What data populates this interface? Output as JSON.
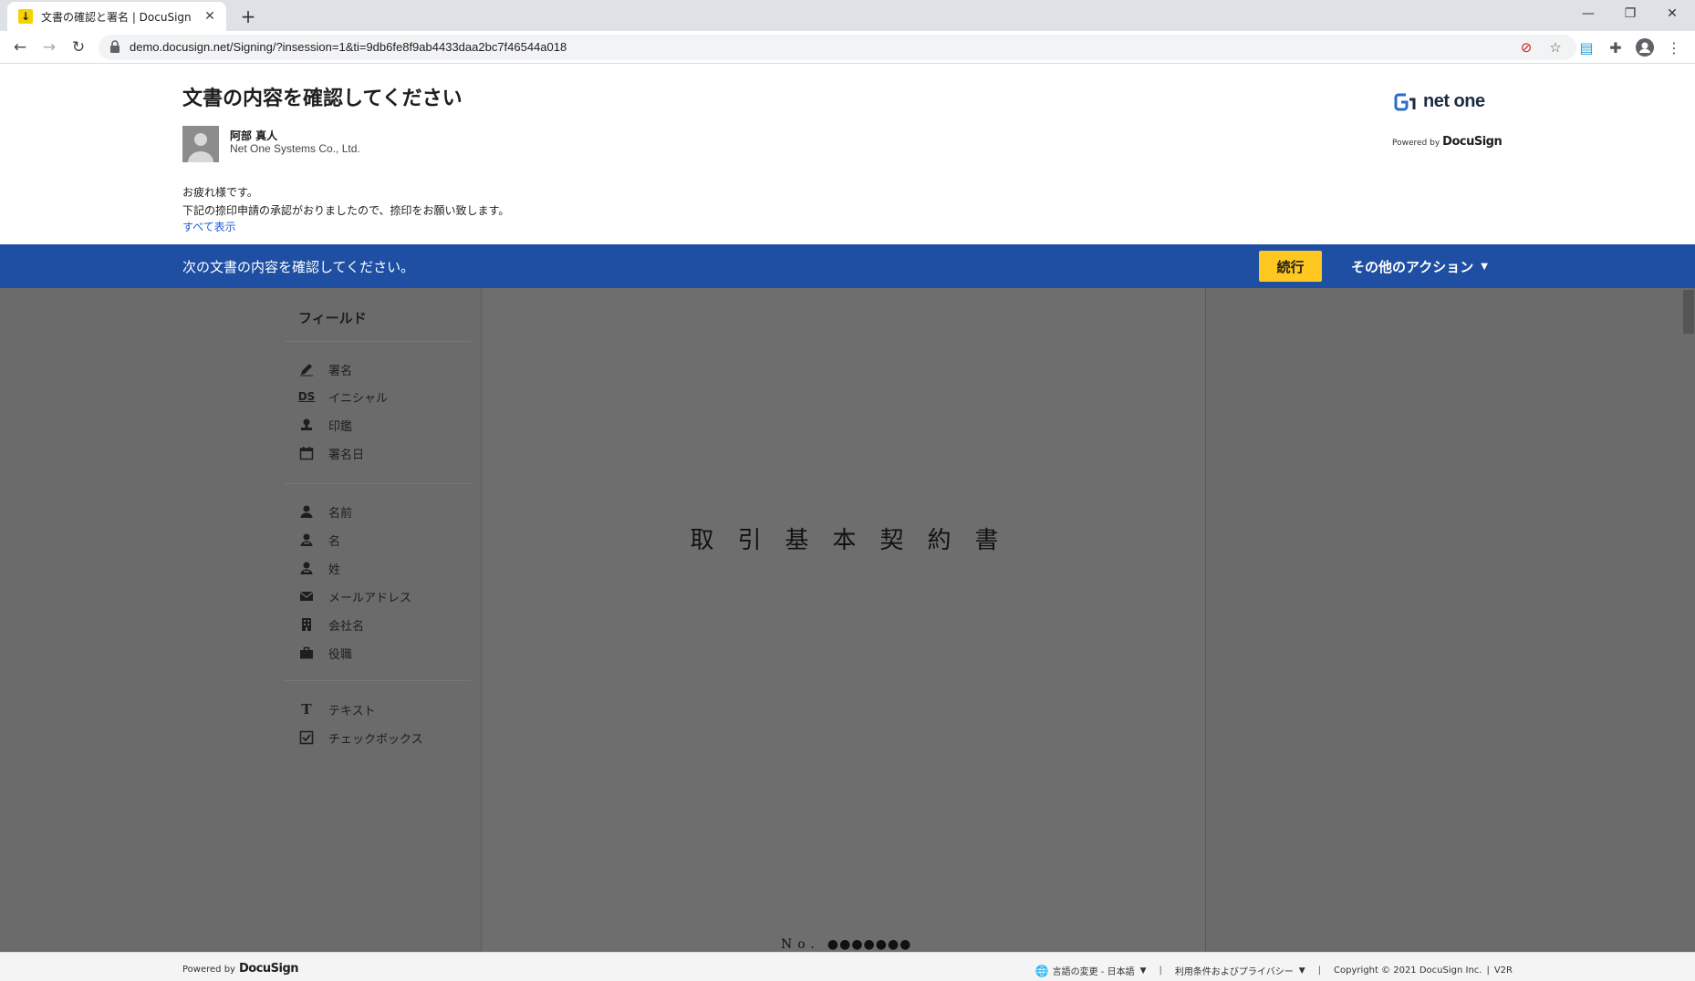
{
  "browser": {
    "tab_title": "文書の確認と署名 | DocuSign",
    "tab_favicon": "download-icon",
    "url": "demo.docusign.net/Signing/?insession=1&ti=9db6fe8f9ab4433daa2bc7f46544a018"
  },
  "header": {
    "title": "文書の内容を確認してください",
    "sender_name": "阿部 真人",
    "sender_company": "Net One Systems Co., Ltd.",
    "message_line1": "お疲れ様です。",
    "message_line2": "下記の捺印申請の承認がおりましたので、捺印をお願い致します。",
    "show_all": "すべて表示",
    "brand_name": "net one",
    "powered_by": "Powered by",
    "powered_brand": "DocuSign"
  },
  "actionbar": {
    "message": "次の文書の内容を確認してください。",
    "continue_label": "続行",
    "other_actions_label": "その他のアクション",
    "colors": {
      "bar": "#1f4fa3",
      "continue": "#ffc820"
    }
  },
  "fields": {
    "title": "フィールド",
    "group1": [
      {
        "icon": "pen-icon",
        "label": "署名"
      },
      {
        "icon": "initials-icon",
        "glyph": "DS",
        "label": "イニシャル"
      },
      {
        "icon": "stamp-icon",
        "label": "印鑑"
      },
      {
        "icon": "calendar-icon",
        "label": "署名日"
      }
    ],
    "group2": [
      {
        "icon": "person-icon",
        "label": "名前"
      },
      {
        "icon": "person-icon",
        "label": "名"
      },
      {
        "icon": "person-icon",
        "label": "姓"
      },
      {
        "icon": "envelope-icon",
        "label": "メールアドレス"
      },
      {
        "icon": "building-icon",
        "label": "会社名"
      },
      {
        "icon": "briefcase-icon",
        "label": "役職"
      }
    ],
    "group3": [
      {
        "icon": "text-icon",
        "glyph": "T",
        "label": "テキスト"
      },
      {
        "icon": "checkbox-icon",
        "label": "チェックボックス"
      }
    ]
  },
  "document": {
    "title": "取引基本契約書",
    "number_label": "No.",
    "number_masked": "●●●●●●●"
  },
  "footer": {
    "powered_by": "Powered by",
    "powered_brand": "DocuSign",
    "language": "言語の変更 - 日本語",
    "terms": "利用条件およびプライバシー",
    "copyright": "Copyright © 2021 DocuSign Inc.",
    "version": "V2R"
  }
}
